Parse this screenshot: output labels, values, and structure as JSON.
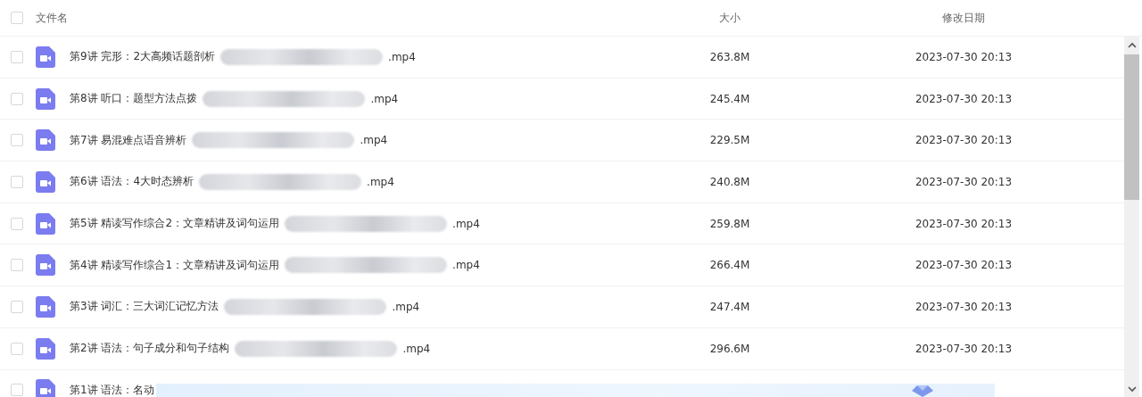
{
  "header": {
    "checked": false,
    "columns": [
      "文件名",
      "大小",
      "修改日期"
    ]
  },
  "rows": [
    {
      "checked": false,
      "name_start": "第9讲 完形：2大高频话题剖析",
      "name_end": ".mp4",
      "size": "263.8M",
      "date": "2023-07-30 20:13"
    },
    {
      "checked": false,
      "name_start": "第8讲 听口：题型方法点拨",
      "name_end": ".mp4",
      "size": "245.4M",
      "date": "2023-07-30 20:13"
    },
    {
      "checked": false,
      "name_start": "第7讲 易混难点语音辨析",
      "name_end": ".mp4",
      "size": "229.5M",
      "date": "2023-07-30 20:13"
    },
    {
      "checked": false,
      "name_start": "第6讲 语法：4大时态辨析",
      "name_end": ".mp4",
      "size": "240.8M",
      "date": "2023-07-30 20:13"
    },
    {
      "checked": false,
      "name_start": "第5讲 精读写作综合2：文章精讲及词句运用",
      "name_end": ".mp4",
      "size": "259.8M",
      "date": "2023-07-30 20:13"
    },
    {
      "checked": false,
      "name_start": "第4讲 精读写作综合1：文章精讲及词句运用",
      "name_end": ".mp4",
      "size": "266.4M",
      "date": "2023-07-30 20:13"
    },
    {
      "checked": false,
      "name_start": "第3讲 词汇：三大词汇记忆方法",
      "name_end": ".mp4",
      "size": "247.4M",
      "date": "2023-07-30 20:13"
    },
    {
      "checked": false,
      "name_start": "第2讲 语法：句子成分和句子结构",
      "name_end": ".mp4",
      "size": "296.6M",
      "date": "2023-07-30 20:13"
    },
    {
      "checked": false,
      "name_start": "第1讲 语法：名动"
    }
  ]
}
